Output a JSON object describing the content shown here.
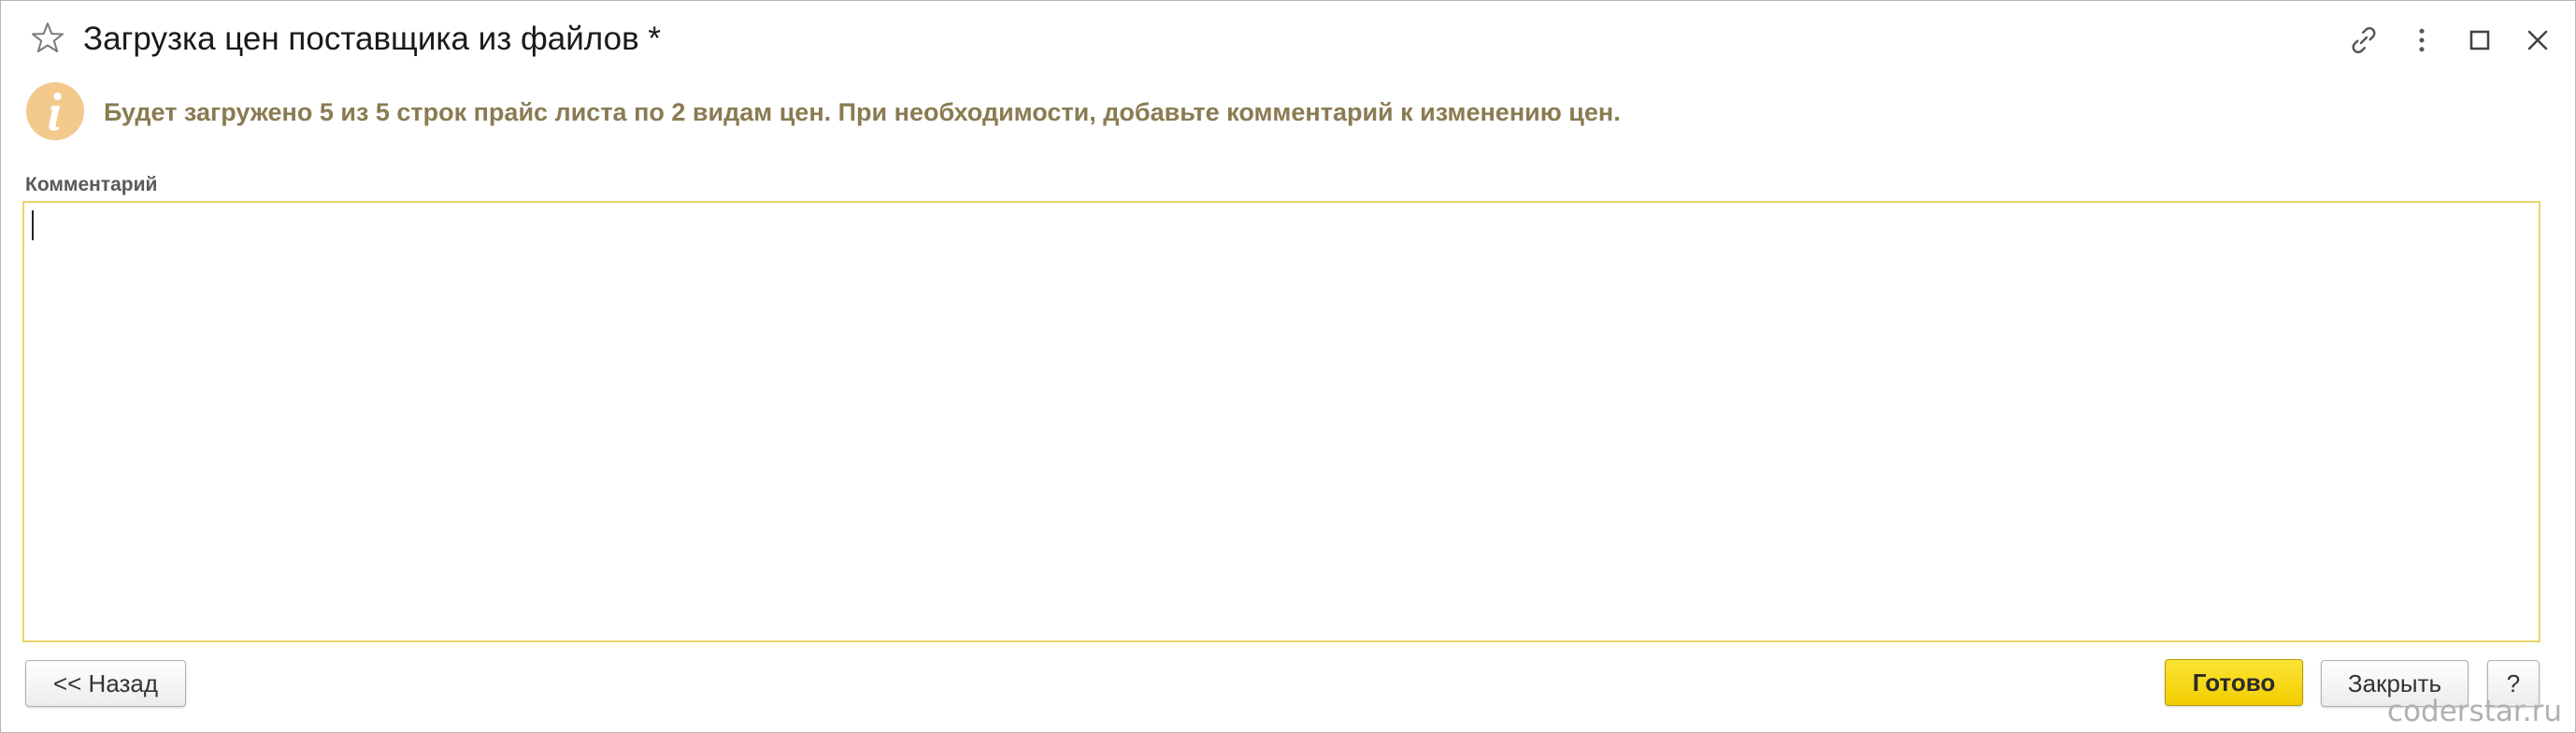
{
  "window": {
    "title": "Загрузка цен поставщика из файлов *"
  },
  "info": {
    "message": "Будет загружено 5 из 5 строк прайс листа по 2 видам цен. При необходимости, добавьте комментарий к изменению цен."
  },
  "comment": {
    "label": "Комментарий",
    "value": ""
  },
  "buttons": {
    "back": "<< Назад",
    "done": "Готово",
    "close": "Закрыть",
    "help": "?"
  },
  "watermark": "coderstar.ru",
  "colors": {
    "accent_yellow": "#f5d500",
    "field_border": "#e8d56a",
    "info_text": "#8a7b52",
    "info_icon": "#f3c98c"
  },
  "icons": {
    "favorite": "star-icon",
    "link": "link-icon",
    "more": "more-vertical-icon",
    "maximize": "maximize-icon",
    "close": "close-icon",
    "info": "info-icon"
  }
}
